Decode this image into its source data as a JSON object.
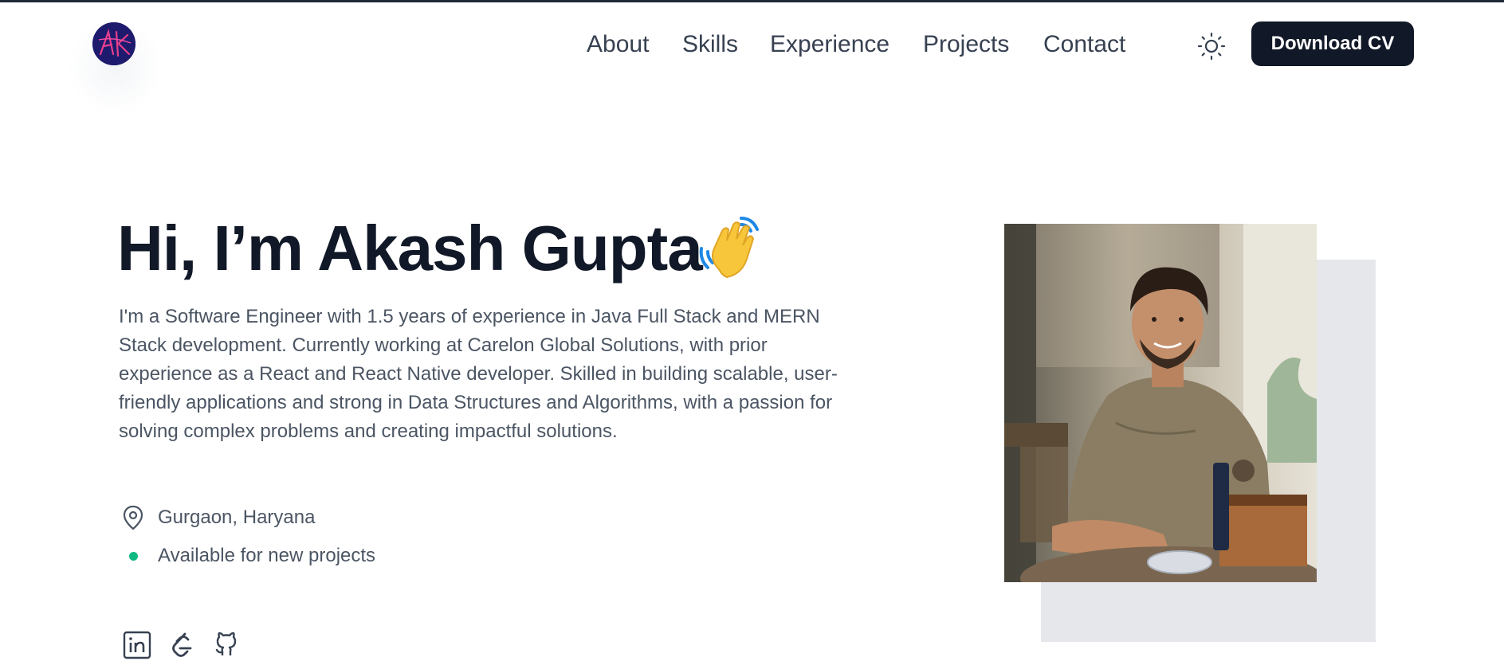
{
  "header": {
    "logo_text": "AK",
    "nav": [
      {
        "label": "About"
      },
      {
        "label": "Skills"
      },
      {
        "label": "Experience"
      },
      {
        "label": "Projects"
      },
      {
        "label": "Contact"
      }
    ],
    "theme_icon": "sun-icon",
    "cv_button": "Download CV"
  },
  "hero": {
    "title": "Hi, I’m Akash Gupta",
    "wave_icon": "waving-hand-icon",
    "bio_lines": [
      "I'm a Software Engineer with 1.5 years of experience in Java Full Stack and MERN",
      "Stack development. Currently working at Carelon Global Solutions, with prior",
      "experience as a React and React Native developer. Skilled in building scalable, user-",
      "friendly applications and strong in Data Structures and Algorithms, with a passion for",
      "solving complex problems and creating impactful solutions."
    ],
    "location": "Gurgaon, Haryana",
    "availability": "Available for new projects",
    "status_color": "#10b981",
    "socials": [
      "linkedin-icon",
      "leetcode-icon",
      "github-icon"
    ]
  },
  "theme": {
    "text_dark": "#111827",
    "text_muted": "#4b5563",
    "button_bg": "#111827",
    "photo_backdrop": "#e5e7eb"
  }
}
